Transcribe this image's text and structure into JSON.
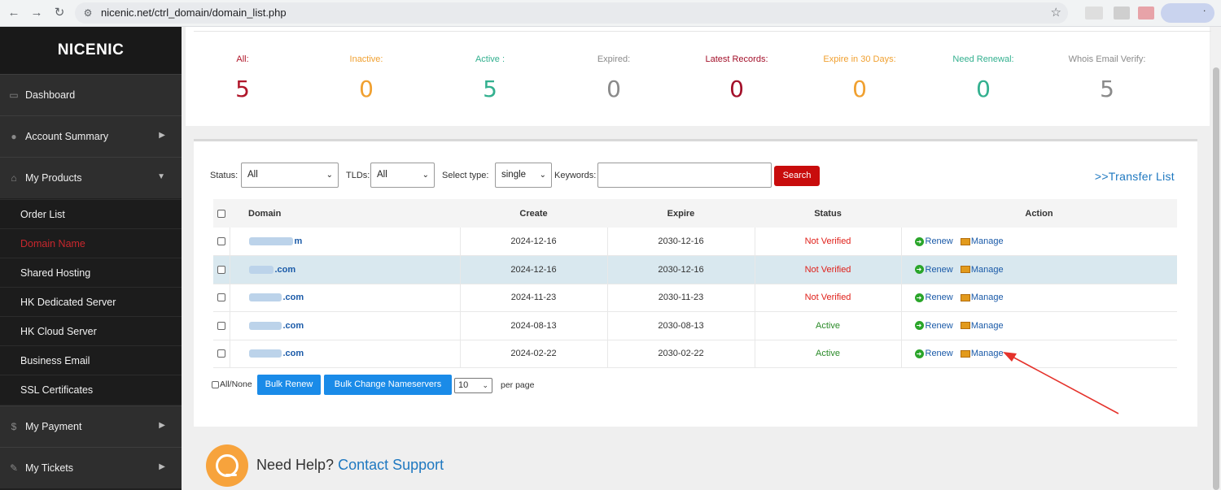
{
  "browser": {
    "url": "nicenic.net/ctrl_domain/domain_list.php",
    "back_icon": "←",
    "forward_icon": "→",
    "reload_icon": "↻",
    "tune_icon": "⚙",
    "star_icon": "☆",
    "menu_icon": "."
  },
  "sidebar": {
    "brand": "NICENIC",
    "items": [
      {
        "label": "Dashboard",
        "icon": "monitor-icon",
        "glyph": "▭"
      },
      {
        "label": "Account Summary",
        "icon": "user-icon",
        "glyph": "●",
        "arrow": "▶"
      },
      {
        "label": "My Products",
        "icon": "basket-icon",
        "glyph": "⌂",
        "arrow": "▼"
      },
      {
        "label": "My Payment",
        "icon": "money-bag-icon",
        "glyph": "$",
        "arrow": "▶"
      },
      {
        "label": "My Tickets",
        "icon": "edit-icon",
        "glyph": "✎",
        "arrow": "▶"
      }
    ],
    "sub_items": [
      {
        "label": "Order List"
      },
      {
        "label": "Domain Name",
        "active": true
      },
      {
        "label": "Shared Hosting"
      },
      {
        "label": "HK Dedicated Server"
      },
      {
        "label": "HK Cloud Server"
      },
      {
        "label": "Business Email"
      },
      {
        "label": "SSL Certificates"
      }
    ]
  },
  "stats": [
    {
      "label": "All:",
      "value": "5",
      "color": "#b0162a"
    },
    {
      "label": "Inactive:",
      "value": "0",
      "color": "#f0a030"
    },
    {
      "label": "Active :",
      "value": "5",
      "color": "#33b08f"
    },
    {
      "label": "Expired:",
      "value": "0",
      "color": "#8a8a8a"
    },
    {
      "label": "Latest Records:",
      "value": "0",
      "color": "#a3102a"
    },
    {
      "label": "Expire in 30 Days:",
      "value": "0",
      "color": "#f0a030"
    },
    {
      "label": "Need Renewal:",
      "value": "0",
      "color": "#33b08f"
    },
    {
      "label": "Whois Email Verify:",
      "value": "5",
      "color": "#8a8a8a"
    }
  ],
  "filters": {
    "status_label": "Status:",
    "status_value": "All",
    "tlds_label": "TLDs:",
    "tlds_value": "All",
    "type_label": "Select type:",
    "type_value": "single",
    "keywords_label": "Keywords:",
    "keywords_value": "",
    "search_button": "Search",
    "transfer_link": ">>Transfer List",
    "caret": "⌄"
  },
  "table": {
    "headers": {
      "domain": "Domain",
      "create": "Create",
      "expire": "Expire",
      "status": "Status",
      "action": "Action"
    },
    "renew_label": "Renew",
    "manage_label": "Manage",
    "renew_glyph": "➜",
    "rows": [
      {
        "domain_visible": "m",
        "create": "2024-12-16",
        "expire": "2030-12-16",
        "status": "Not Verified",
        "highlight": false
      },
      {
        "domain_visible": ".com",
        "create": "2024-12-16",
        "expire": "2030-12-16",
        "status": "Not Verified",
        "highlight": true
      },
      {
        "domain_visible": ".com",
        "create": "2024-11-23",
        "expire": "2030-11-23",
        "status": "Not Verified",
        "highlight": false
      },
      {
        "domain_visible": ".com",
        "create": "2024-08-13",
        "expire": "2030-08-13",
        "status": "Active",
        "highlight": false
      },
      {
        "domain_visible": ".com",
        "create": "2024-02-22",
        "expire": "2030-02-22",
        "status": "Active",
        "highlight": false
      }
    ]
  },
  "bulk": {
    "all_none": "All/None",
    "bulk_renew": "Bulk Renew",
    "bulk_change_ns": "Bulk Change Nameservers",
    "per_page_value": "10",
    "per_page_label": "per page"
  },
  "help": {
    "text": "Need Help?",
    "link": "Contact Support"
  }
}
